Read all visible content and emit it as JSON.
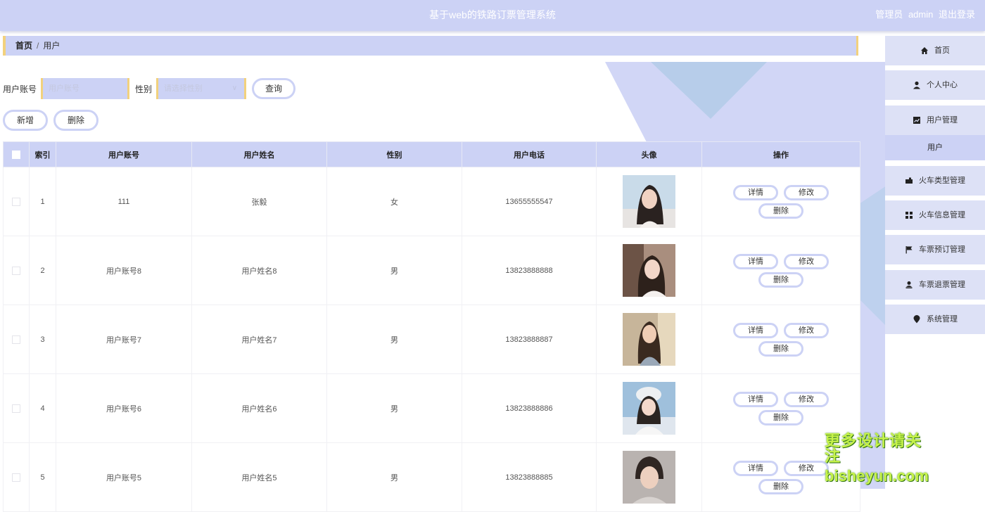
{
  "header": {
    "title": "基于web的铁路订票管理系统",
    "role": "管理员",
    "username": "admin",
    "logout_label": "退出登录"
  },
  "breadcrumb": {
    "home": "首页",
    "separator": "/",
    "current": "用户"
  },
  "search": {
    "account_label": "用户账号",
    "account_placeholder": "用户账号",
    "gender_label": "性别",
    "gender_placeholder": "请选择性别",
    "query_button": "查询"
  },
  "actions": {
    "add_button": "新增",
    "delete_button": "删除"
  },
  "table": {
    "columns": [
      "索引",
      "用户账号",
      "用户姓名",
      "性别",
      "用户电话",
      "头像",
      "操作"
    ],
    "row_actions": {
      "detail": "详情",
      "edit": "修改",
      "delete": "删除"
    },
    "rows": [
      {
        "index": "1",
        "account": "111",
        "name": "张毅",
        "gender": "女",
        "phone": "13655555547"
      },
      {
        "index": "2",
        "account": "用户账号8",
        "name": "用户姓名8",
        "gender": "男",
        "phone": "13823888888"
      },
      {
        "index": "3",
        "account": "用户账号7",
        "name": "用户姓名7",
        "gender": "男",
        "phone": "13823888887"
      },
      {
        "index": "4",
        "account": "用户账号6",
        "name": "用户姓名6",
        "gender": "男",
        "phone": "13823888886"
      },
      {
        "index": "5",
        "account": "用户账号5",
        "name": "用户姓名5",
        "gender": "男",
        "phone": "13823888885"
      }
    ]
  },
  "sidebar": {
    "items": [
      {
        "label": "首页",
        "icon": "home-icon"
      },
      {
        "label": "个人中心",
        "icon": "person-icon"
      },
      {
        "label": "用户管理",
        "icon": "chart-icon"
      },
      {
        "label": "火车类型管理",
        "icon": "train-icon"
      },
      {
        "label": "火车信息管理",
        "icon": "grid-icon"
      },
      {
        "label": "车票预订管理",
        "icon": "flag-icon"
      },
      {
        "label": "车票退票管理",
        "icon": "user-stamp-icon"
      },
      {
        "label": "系统管理",
        "icon": "pin-icon"
      }
    ],
    "sub_item": "用户"
  },
  "watermark": {
    "line1": "更多设计请关注",
    "line2": "bisheyun.com"
  },
  "colors": {
    "accent": "#ccd2f5",
    "border_accent": "#f2d17d",
    "sidebar_item": "#dde1f6"
  }
}
